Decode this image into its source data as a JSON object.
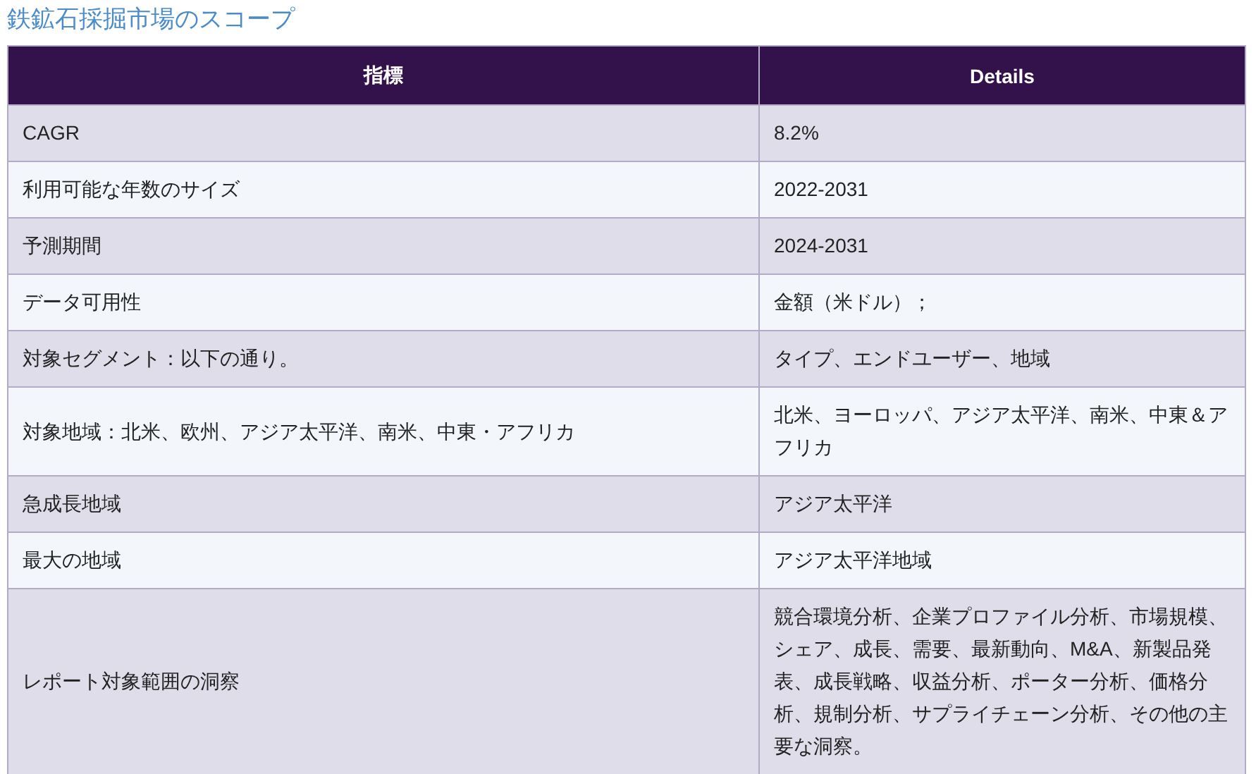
{
  "title": "鉄鉱石採掘市場のスコープ",
  "table": {
    "columns": [
      "指標",
      "Details"
    ],
    "rows": [
      {
        "cells": [
          "CAGR",
          "8.2%"
        ]
      },
      {
        "cells": [
          "利用可能な年数のサイズ",
          "2022-2031"
        ]
      },
      {
        "cells": [
          "予測期間",
          "2024-2031"
        ]
      },
      {
        "cells": [
          "データ可用性",
          "金額（米ドル）；"
        ]
      },
      {
        "cells": [
          "対象セグメント：以下の通り。",
          "タイプ、エンドユーザー、地域"
        ]
      },
      {
        "cells": [
          "対象地域：北米、欧州、アジア太平洋、南米、中東・アフリカ",
          "北米、ヨーロッパ、アジア太平洋、南米、中東＆アフリカ"
        ]
      },
      {
        "cells": [
          "急成長地域",
          "アジア太平洋"
        ]
      },
      {
        "cells": [
          "最大の地域",
          "アジア太平洋地域"
        ]
      },
      {
        "cells": [
          "レポート対象範囲の洞察",
          "競合環境分析、企業プロファイル分析、市場規模、シェア、成長、需要、最新動向、M&A、新製品発表、成長戦略、収益分析、ポーター分析、価格分析、規制分析、サプライチェーン分析、その他の主要な洞察。"
        ]
      }
    ]
  }
}
